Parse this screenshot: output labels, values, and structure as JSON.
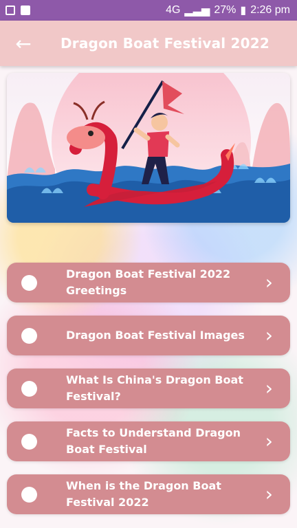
{
  "status": {
    "network": "4G",
    "battery": "27%",
    "time": "2:26 pm"
  },
  "app": {
    "title": "Dragon Boat Festival 2022",
    "back_label": "←"
  },
  "menu": [
    {
      "label": "Dragon Boat Festival 2022 Greetings",
      "chevron": "›"
    },
    {
      "label": "Dragon Boat Festival Images",
      "chevron": "›"
    },
    {
      "label": "What Is China's Dragon Boat Festival?",
      "chevron": "›"
    },
    {
      "label": "Facts to Understand Dragon Boat Festival",
      "chevron": "›"
    },
    {
      "label": "When is the Dragon Boat Festival 2022",
      "chevron": "›"
    }
  ]
}
